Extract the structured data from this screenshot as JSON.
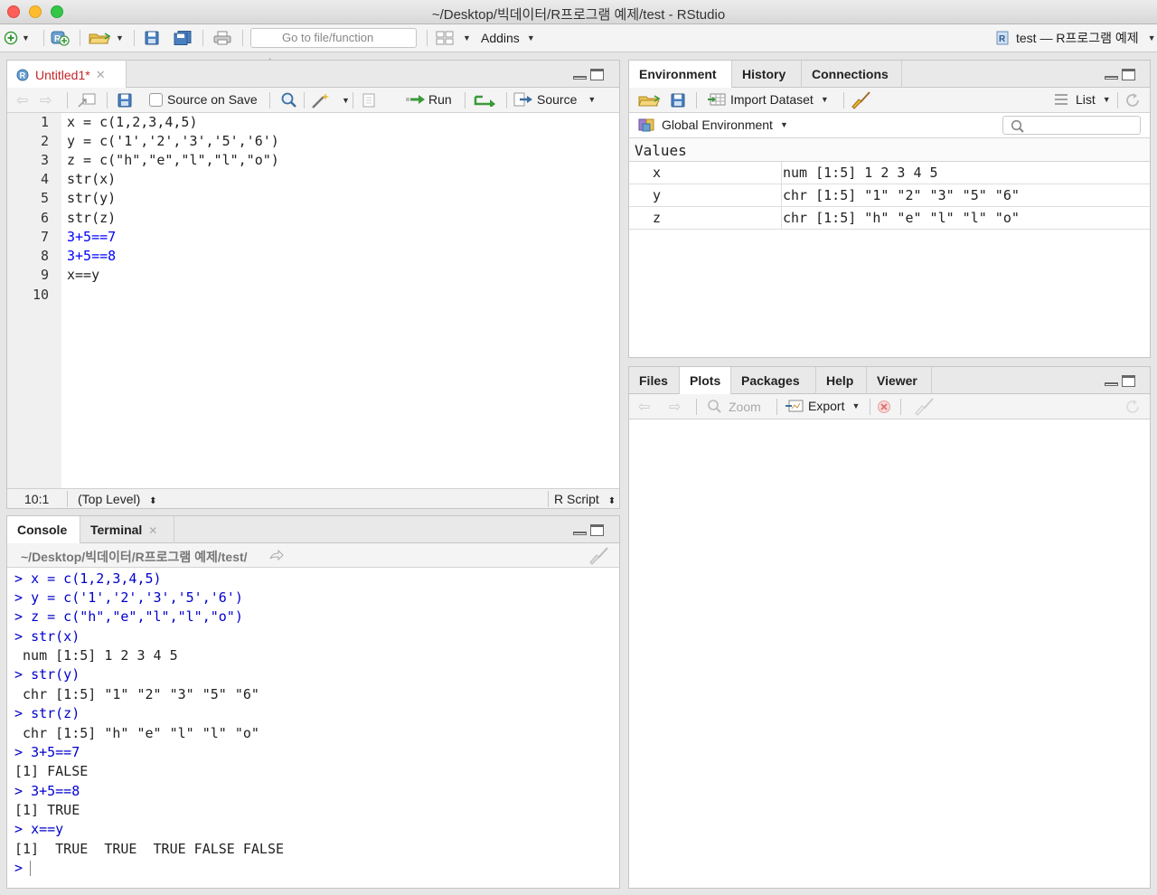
{
  "window": {
    "title": "~/Desktop/빅데이터/R프로그램 예제/test - RStudio",
    "colors": {
      "close": "#fc5f57",
      "minimize": "#fdbc2e",
      "maximize": "#33c748"
    }
  },
  "main_toolbar": {
    "goto_placeholder": "Go to file/function",
    "addins_label": "Addins",
    "project_label": "test — R프로그램 예제"
  },
  "editor": {
    "tab_label": "Untitled1*",
    "source_on_save_label": "Source on Save",
    "run_label": "Run",
    "source_label": "Source",
    "line_numbers": [
      "1",
      "2",
      "3",
      "4",
      "5",
      "6",
      "7",
      "8",
      "9",
      "10"
    ],
    "lines": [
      "x = c(1,2,3,4,5)",
      "y = c('1','2','3','5','6')",
      "z = c(\"h\",\"e\",\"l\",\"l\",\"o\")",
      "str(x)",
      "str(y)",
      "str(z)",
      "3+5==7",
      "3+5==8",
      "x==y",
      ""
    ],
    "cursor_position": "10:1",
    "scope": "(Top Level)",
    "file_type": "R Script"
  },
  "console": {
    "tabs": [
      "Console",
      "Terminal"
    ],
    "path": "~/Desktop/빅데이터/R프로그램 예제/test/",
    "lines": [
      {
        "prompt": ">",
        "text": "x = c(1,2,3,4,5)"
      },
      {
        "prompt": ">",
        "text": "y = c('1','2','3','5','6')"
      },
      {
        "prompt": ">",
        "text": "z = c(\"h\",\"e\",\"l\",\"l\",\"o\")"
      },
      {
        "prompt": ">",
        "text": "str(x)"
      },
      {
        "prompt": "",
        "text": " num [1:5] 1 2 3 4 5"
      },
      {
        "prompt": ">",
        "text": "str(y)"
      },
      {
        "prompt": "",
        "text": " chr [1:5] \"1\" \"2\" \"3\" \"5\" \"6\""
      },
      {
        "prompt": ">",
        "text": "str(z)"
      },
      {
        "prompt": "",
        "text": " chr [1:5] \"h\" \"e\" \"l\" \"l\" \"o\""
      },
      {
        "prompt": ">",
        "text": "3+5==7"
      },
      {
        "prompt": "",
        "text": "[1] FALSE"
      },
      {
        "prompt": ">",
        "text": "3+5==8"
      },
      {
        "prompt": "",
        "text": "[1] TRUE"
      },
      {
        "prompt": ">",
        "text": "x==y"
      },
      {
        "prompt": "",
        "text": "[1]  TRUE  TRUE  TRUE FALSE FALSE"
      },
      {
        "prompt": ">",
        "text": ""
      }
    ]
  },
  "environment": {
    "tabs": [
      "Environment",
      "History",
      "Connections"
    ],
    "import_dataset_label": "Import Dataset",
    "list_label": "List",
    "scope_label": "Global Environment",
    "section_label": "Values",
    "rows": [
      {
        "name": "x",
        "value": "num [1:5] 1 2 3 4 5"
      },
      {
        "name": "y",
        "value": "chr [1:5] \"1\" \"2\" \"3\" \"5\" \"6\""
      },
      {
        "name": "z",
        "value": "chr [1:5] \"h\" \"e\" \"l\" \"l\" \"o\""
      }
    ]
  },
  "files": {
    "tabs": [
      "Files",
      "Plots",
      "Packages",
      "Help",
      "Viewer"
    ],
    "zoom_label": "Zoom",
    "export_label": "Export"
  }
}
